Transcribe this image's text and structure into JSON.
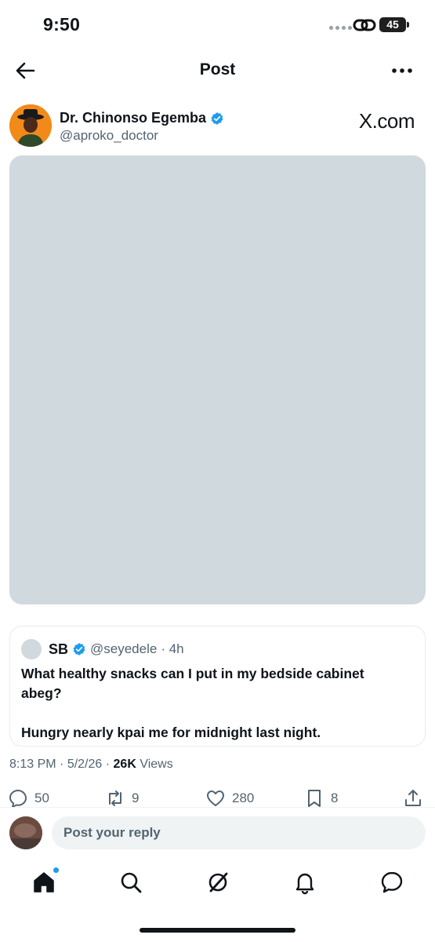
{
  "status_bar": {
    "time": "9:50",
    "battery": "45"
  },
  "nav": {
    "title": "Post"
  },
  "author": {
    "name": "Dr. Chinonso Egemba",
    "handle": "@aproko_doctor",
    "watermark": "X.com"
  },
  "quote": {
    "name": "SB",
    "handle": "@seyedele",
    "age": "· 4h",
    "text": "What healthy snacks can I put in my bedside cabinet abeg?\n\nHungry nearly kpai me for midnight last night."
  },
  "meta": {
    "time": "8:13 PM",
    "date": "5/2/26",
    "views_count": "26K",
    "views_label": "Views"
  },
  "actions": {
    "replies": "50",
    "reposts": "9",
    "likes": "280",
    "bookmarks": "8"
  },
  "reply": {
    "placeholder": "Post your reply"
  },
  "colors": {
    "accent": "#1d9bf0",
    "media_placeholder": "#d0d9de",
    "muted": "#536471"
  },
  "icons": [
    "back-arrow-icon",
    "more-icon",
    "verified-badge-icon",
    "reply-icon",
    "repost-icon",
    "like-icon",
    "bookmark-icon",
    "share-icon",
    "home-icon",
    "search-icon",
    "grok-icon",
    "notifications-icon",
    "messages-icon"
  ]
}
